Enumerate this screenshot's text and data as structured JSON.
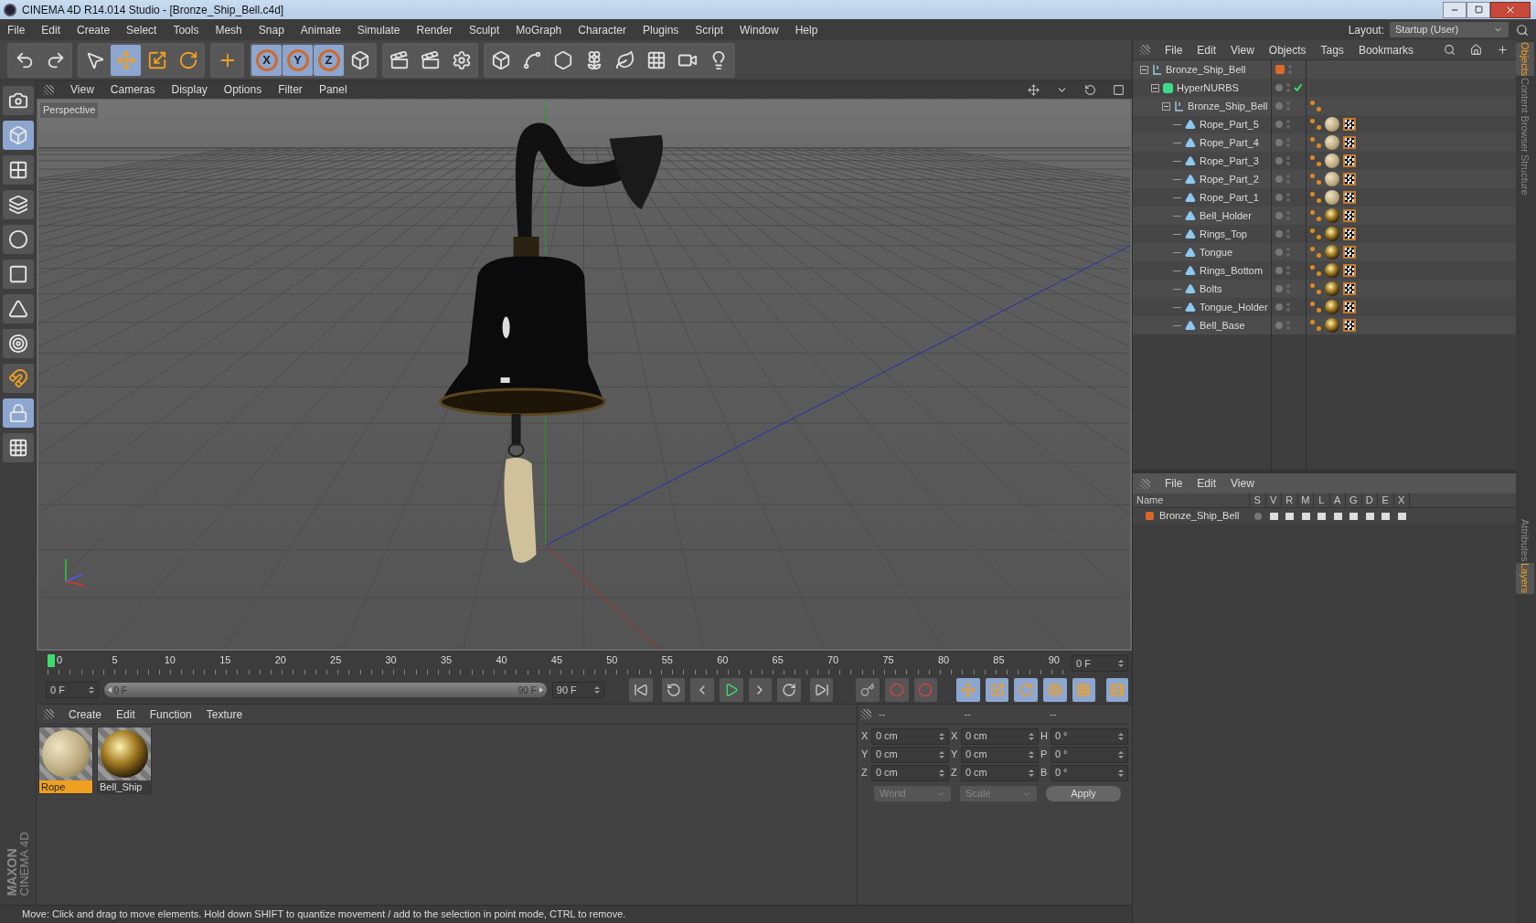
{
  "window": {
    "title": "CINEMA 4D R14.014 Studio - [Bronze_Ship_Bell.c4d]"
  },
  "menu": [
    "File",
    "Edit",
    "Create",
    "Select",
    "Tools",
    "Mesh",
    "Snap",
    "Animate",
    "Simulate",
    "Render",
    "Sculpt",
    "MoGraph",
    "Character",
    "Plugins",
    "Script",
    "Window",
    "Help"
  ],
  "layout": {
    "label": "Layout:",
    "value": "Startup (User)"
  },
  "toolbar": [
    [
      {
        "kind": "undo",
        "selected": false
      },
      {
        "kind": "redo",
        "selected": false
      }
    ],
    [
      {
        "kind": "select",
        "selected": false
      },
      {
        "kind": "move",
        "selected": true
      },
      {
        "kind": "scale",
        "selected": false
      },
      {
        "kind": "rotate",
        "selected": false
      }
    ],
    [
      {
        "kind": "add",
        "selected": false
      }
    ],
    [
      {
        "kind": "axis",
        "label": "X",
        "selected": true
      },
      {
        "kind": "axis",
        "label": "Y",
        "selected": true
      },
      {
        "kind": "axis",
        "label": "Z",
        "selected": true
      },
      {
        "kind": "coords",
        "selected": false
      }
    ],
    [
      {
        "kind": "render-view",
        "selected": false
      },
      {
        "kind": "render-picture",
        "selected": false
      },
      {
        "kind": "render-settings",
        "selected": false
      }
    ],
    [
      {
        "kind": "cube",
        "selected": false
      },
      {
        "kind": "spline",
        "selected": false
      },
      {
        "kind": "nurbs",
        "selected": false
      },
      {
        "kind": "array",
        "selected": false
      },
      {
        "kind": "deformer",
        "selected": false
      },
      {
        "kind": "floor",
        "selected": false
      },
      {
        "kind": "camera",
        "selected": false
      },
      {
        "kind": "light",
        "selected": false
      }
    ]
  ],
  "left_toolbar": [
    {
      "kind": "camera",
      "selected": false
    },
    {
      "kind": "model",
      "selected": true
    },
    {
      "kind": "texture",
      "selected": false
    },
    {
      "kind": "workplane",
      "selected": false
    },
    {
      "kind": "points",
      "selected": false
    },
    {
      "kind": "edges",
      "selected": false
    },
    {
      "kind": "polygons",
      "selected": false
    },
    {
      "kind": "axis",
      "selected": false
    },
    {
      "kind": "magnet",
      "selected": false
    },
    {
      "kind": "lock",
      "selected": true
    },
    {
      "kind": "snap",
      "selected": false
    }
  ],
  "logo": [
    "MAXON",
    "CINEMA 4D"
  ],
  "viewport": {
    "menu": [
      "View",
      "Cameras",
      "Display",
      "Options",
      "Filter",
      "Panel"
    ],
    "label": "Perspective"
  },
  "timeline": {
    "ticks": [
      "0",
      "5",
      "10",
      "15",
      "20",
      "25",
      "30",
      "35",
      "40",
      "45",
      "50",
      "55",
      "60",
      "65",
      "70",
      "75",
      "80",
      "85",
      "90"
    ],
    "level": 0,
    "current": "0 F",
    "start": "0 F",
    "range": {
      "start": "0 F",
      "end": "90 F",
      "level": 1
    },
    "end": "90 F"
  },
  "materials": {
    "menu": [
      "Create",
      "Edit",
      "Function",
      "Texture"
    ],
    "items": [
      {
        "name": "Rope",
        "kind": "rope",
        "selected": true
      },
      {
        "name": "Bell_Ship",
        "kind": "metal",
        "selected": false
      }
    ]
  },
  "coordinates": {
    "headers": [
      "--",
      "--",
      "--"
    ],
    "rows": [
      [
        "X",
        "0 cm",
        "X",
        "0 cm",
        "H",
        "0 °"
      ],
      [
        "Y",
        "0 cm",
        "Y",
        "0 cm",
        "P",
        "0 °"
      ],
      [
        "Z",
        "0 cm",
        "Z",
        "0 cm",
        "B",
        "0 °"
      ]
    ],
    "mode": "World",
    "type": "Scale",
    "apply": "Apply"
  },
  "objects": {
    "menu": [
      "File",
      "Edit",
      "View",
      "Objects",
      "Tags",
      "Bookmarks"
    ],
    "tree": [
      {
        "name": "Bronze_Ship_Bell",
        "kind": "null",
        "color": "#d9692b",
        "expanded": true,
        "children": [
          {
            "name": "HyperNURBS",
            "kind": "nurbs",
            "enabled": true,
            "expanded": true,
            "children": [
              {
                "name": "Bronze_Ship_Bell",
                "kind": "null",
                "tags": [
                  {
                    "kind": "phong"
                  }
                ],
                "expanded": true,
                "children": [
                  {
                    "name": "Rope_Part_5",
                    "kind": "mesh",
                    "tags": [
                      {
                        "kind": "phong"
                      },
                      {
                        "kind": "rope"
                      },
                      {
                        "kind": "uvw"
                      }
                    ]
                  },
                  {
                    "name": "Rope_Part_4",
                    "kind": "mesh",
                    "tags": [
                      {
                        "kind": "phong"
                      },
                      {
                        "kind": "rope"
                      },
                      {
                        "kind": "uvw"
                      }
                    ]
                  },
                  {
                    "name": "Rope_Part_3",
                    "kind": "mesh",
                    "tags": [
                      {
                        "kind": "phong"
                      },
                      {
                        "kind": "rope"
                      },
                      {
                        "kind": "uvw"
                      }
                    ]
                  },
                  {
                    "name": "Rope_Part_2",
                    "kind": "mesh",
                    "tags": [
                      {
                        "kind": "phong"
                      },
                      {
                        "kind": "rope"
                      },
                      {
                        "kind": "uvw"
                      }
                    ]
                  },
                  {
                    "name": "Rope_Part_1",
                    "kind": "mesh",
                    "tags": [
                      {
                        "kind": "phong"
                      },
                      {
                        "kind": "rope"
                      },
                      {
                        "kind": "uvw"
                      }
                    ]
                  },
                  {
                    "name": "Bell_Holder",
                    "kind": "mesh",
                    "tags": [
                      {
                        "kind": "phong"
                      },
                      {
                        "kind": "metal"
                      },
                      {
                        "kind": "uvw"
                      }
                    ]
                  },
                  {
                    "name": "Rings_Top",
                    "kind": "mesh",
                    "tags": [
                      {
                        "kind": "phong"
                      },
                      {
                        "kind": "metal"
                      },
                      {
                        "kind": "uvw"
                      }
                    ]
                  },
                  {
                    "name": "Tongue",
                    "kind": "mesh",
                    "tags": [
                      {
                        "kind": "phong"
                      },
                      {
                        "kind": "metal"
                      },
                      {
                        "kind": "uvw"
                      }
                    ]
                  },
                  {
                    "name": "Rings_Bottom",
                    "kind": "mesh",
                    "tags": [
                      {
                        "kind": "phong"
                      },
                      {
                        "kind": "metal"
                      },
                      {
                        "kind": "uvw"
                      }
                    ]
                  },
                  {
                    "name": "Bolts",
                    "kind": "mesh",
                    "tags": [
                      {
                        "kind": "phong"
                      },
                      {
                        "kind": "metal"
                      },
                      {
                        "kind": "uvw"
                      }
                    ]
                  },
                  {
                    "name": "Tongue_Holder",
                    "kind": "mesh",
                    "tags": [
                      {
                        "kind": "phong"
                      },
                      {
                        "kind": "metal"
                      },
                      {
                        "kind": "uvw"
                      }
                    ]
                  },
                  {
                    "name": "Bell_Base",
                    "kind": "mesh",
                    "tags": [
                      {
                        "kind": "phong"
                      },
                      {
                        "kind": "metal"
                      },
                      {
                        "kind": "uvw"
                      }
                    ]
                  }
                ]
              }
            ]
          }
        ]
      }
    ]
  },
  "layers": {
    "menu": [
      "File",
      "Edit",
      "View"
    ],
    "columns": [
      "Name",
      "S",
      "V",
      "R",
      "M",
      "L",
      "A",
      "G",
      "D",
      "E",
      "X"
    ],
    "rows": [
      {
        "name": "Bronze_Ship_Bell",
        "color": "#d9692b"
      }
    ]
  },
  "side_tabs_top": [
    {
      "label": "Objects",
      "selected": true
    },
    {
      "label": "Content Browser",
      "selected": false
    },
    {
      "label": "Structure",
      "selected": false
    }
  ],
  "side_tabs_bottom": [
    {
      "label": "Attributes",
      "selected": false
    },
    {
      "label": "Layers",
      "selected": true
    }
  ],
  "status_bar": "Move: Click and drag to move elements. Hold down SHIFT to quantize movement / add to the selection in point mode, CTRL to remove."
}
